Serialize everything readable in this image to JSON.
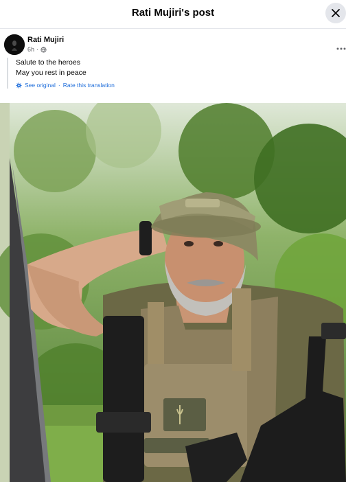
{
  "header": {
    "title": "Rati Mujiri's post",
    "close_icon": "close-icon"
  },
  "post": {
    "author": "Rati Mujiri",
    "time": "6h",
    "audience_icon": "globe-icon",
    "more_icon": "more-options-icon",
    "text_lines": [
      "Salute to the heroes",
      "May you rest in peace"
    ],
    "translation": {
      "icon": "gear-icon",
      "see_original": "See original",
      "separator": "·",
      "rate": "Rate this translation"
    }
  },
  "photo": {
    "colors": {
      "foliage": "#5f8a3a",
      "shirt": "#6b6845",
      "sky": "#e8efe4"
    }
  }
}
